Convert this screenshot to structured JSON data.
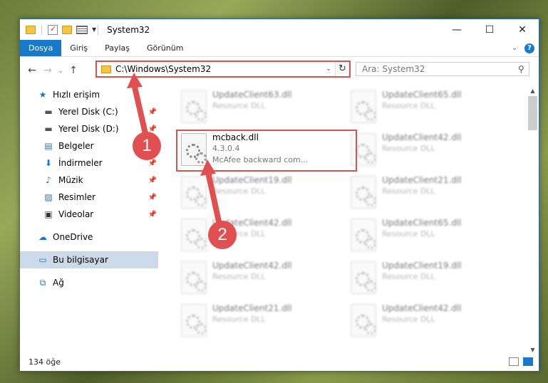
{
  "window": {
    "title": "System32",
    "controls": [
      "—",
      "☐",
      "✕"
    ]
  },
  "ribbon": {
    "tabs": [
      "Dosya",
      "Giriş",
      "Paylaş",
      "Görünüm"
    ],
    "active_tab": "Dosya",
    "accent_color": "#1979ca"
  },
  "nav": {
    "back": "←",
    "forward": "→",
    "recent": "⌄",
    "up": "↑"
  },
  "address": {
    "path": "C:\\Windows\\System32",
    "refresh_glyph": "↻"
  },
  "search": {
    "placeholder": "Ara: System32",
    "icon": "search-icon"
  },
  "sidebar": {
    "items": [
      {
        "label": "Hızlı erişim",
        "icon": "star-icon",
        "glyph": "★",
        "pinned": false
      },
      {
        "label": "Yerel Disk (C:)",
        "icon": "drive-icon",
        "glyph": "▬",
        "pinned": true
      },
      {
        "label": "Yerel Disk (D:)",
        "icon": "drive-icon",
        "glyph": "▬",
        "pinned": true
      },
      {
        "label": "Belgeler",
        "icon": "documents-icon",
        "glyph": "▤",
        "pinned": true
      },
      {
        "label": "İndirmeler",
        "icon": "downloads-icon",
        "glyph": "⬇",
        "pinned": true
      },
      {
        "label": "Müzik",
        "icon": "music-icon",
        "glyph": "♪",
        "pinned": true
      },
      {
        "label": "Resimler",
        "icon": "pictures-icon",
        "glyph": "▨",
        "pinned": true
      },
      {
        "label": "Videolar",
        "icon": "videos-icon",
        "glyph": "▣",
        "pinned": true
      },
      {
        "label": "OneDrive",
        "icon": "cloud-icon",
        "glyph": "☁",
        "pinned": false
      },
      {
        "label": "Bu bilgisayar",
        "icon": "computer-icon",
        "glyph": "▭",
        "pinned": false,
        "selected": true
      },
      {
        "label": "Ağ",
        "icon": "network-icon",
        "glyph": "⧉",
        "pinned": false
      }
    ]
  },
  "files": {
    "left": [
      {
        "name": "UpdateClient63.dll",
        "sub": "Resource DLL"
      },
      {
        "name": "mcback.dll",
        "sub": "4.3.0.4",
        "sub2": "McAfee backward com...",
        "highlighted": true
      },
      {
        "name": "UpdateClient19.dll",
        "sub": "Resource DLL"
      },
      {
        "name": "UpdateClient42.dll",
        "sub": "Resource DLL"
      },
      {
        "name": "UpdateClient42.dll",
        "sub": "Resource DLL"
      },
      {
        "name": "UpdateClient21.dll",
        "sub": "Resource DLL"
      }
    ],
    "right": [
      {
        "name": "UpdateClient65.dll",
        "sub": "Resource DLL"
      },
      {
        "name": "UpdateClient42.dll",
        "sub": "Resource DLL"
      },
      {
        "name": "UpdateClient21.dll",
        "sub": "Resource DLL"
      },
      {
        "name": "UpdateClient65.dll",
        "sub": "Resource DLL"
      },
      {
        "name": "UpdateClient19.dll",
        "sub": "Resource DLL"
      },
      {
        "name": "UpdateClient42.dll",
        "sub": "Resource DLL"
      }
    ]
  },
  "status": {
    "count": "134 öğe"
  },
  "callouts": [
    "1",
    "2"
  ],
  "annotation_color": "#e05050"
}
